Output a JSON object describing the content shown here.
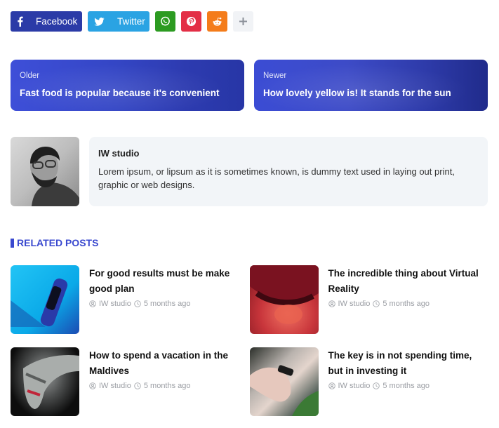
{
  "share": {
    "facebook_label": "Facebook",
    "twitter_label": "Twitter",
    "buttons": [
      {
        "name": "facebook",
        "icon": "facebook-icon",
        "color": "#2b3ba7"
      },
      {
        "name": "twitter",
        "icon": "twitter-icon",
        "color": "#2aa3e3"
      },
      {
        "name": "whatsapp",
        "icon": "whatsapp-icon",
        "color": "#2c9b21"
      },
      {
        "name": "pinterest",
        "icon": "pinterest-icon",
        "color": "#e32f46"
      },
      {
        "name": "reddit",
        "icon": "reddit-icon",
        "color": "#f47c1a"
      },
      {
        "name": "more",
        "icon": "plus-icon",
        "color": "#f1f3f6"
      }
    ]
  },
  "post_nav": {
    "older": {
      "label": "Older",
      "title": "Fast food is popular because it's convenient"
    },
    "newer": {
      "label": "Newer",
      "title": "How lovely yellow is! It stands for the sun"
    }
  },
  "author": {
    "name": "IW studio",
    "bio": "Lorem ipsum, or lipsum as it is sometimes known, is dummy text used in laying out print, graphic or web designs."
  },
  "related": {
    "heading": "RELATED POSTS",
    "accent": "#3a49cf",
    "posts": [
      {
        "title": "For good results must be make good plan",
        "author": "IW studio",
        "time": "5 months ago"
      },
      {
        "title": "The incredible thing about Virtual Reality",
        "author": "IW studio",
        "time": "5 months ago"
      },
      {
        "title": "How to spend a vacation in the Maldives",
        "author": "IW studio",
        "time": "5 months ago"
      },
      {
        "title": "The key is in not spending time, but in investing it",
        "author": "IW studio",
        "time": "5 months ago"
      }
    ]
  }
}
